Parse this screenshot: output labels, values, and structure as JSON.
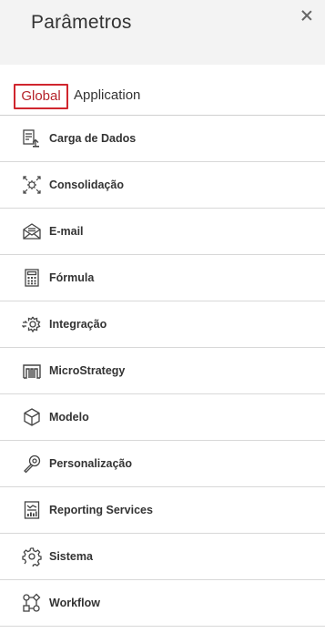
{
  "header": {
    "title": "Parâmetros"
  },
  "tabs": {
    "global": "Global",
    "application": "Application"
  },
  "items": [
    {
      "label": "Carga de Dados",
      "icon": "data-load-icon"
    },
    {
      "label": "Consolidação",
      "icon": "consolidation-icon"
    },
    {
      "label": "E-mail",
      "icon": "email-icon"
    },
    {
      "label": "Fórmula",
      "icon": "calculator-icon"
    },
    {
      "label": "Integração",
      "icon": "integration-gear-icon"
    },
    {
      "label": "MicroStrategy",
      "icon": "microstrategy-icon"
    },
    {
      "label": "Modelo",
      "icon": "cube-icon"
    },
    {
      "label": "Personalização",
      "icon": "wrench-icon"
    },
    {
      "label": "Reporting Services",
      "icon": "report-icon"
    },
    {
      "label": "Sistema",
      "icon": "gear-icon"
    },
    {
      "label": "Workflow",
      "icon": "workflow-icon"
    }
  ],
  "colors": {
    "accent": "#d0262e",
    "active_text": "#b5232a"
  }
}
